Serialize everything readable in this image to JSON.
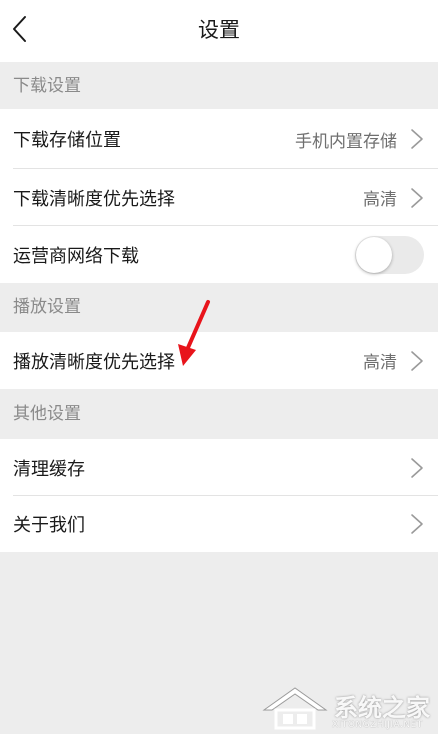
{
  "header": {
    "title": "设置",
    "back_icon": "chevron-left-icon"
  },
  "sections": {
    "download": {
      "title": "下载设置",
      "storage_location": {
        "label": "下载存储位置",
        "value": "手机内置存储"
      },
      "download_quality": {
        "label": "下载清晰度优先选择",
        "value": "高清"
      },
      "carrier_network": {
        "label": "运营商网络下载",
        "toggle_on": false
      }
    },
    "playback": {
      "title": "播放设置",
      "playback_quality": {
        "label": "播放清晰度优先选择",
        "value": "高清"
      }
    },
    "other": {
      "title": "其他设置",
      "clear_cache": {
        "label": "清理缓存"
      },
      "about_us": {
        "label": "关于我们"
      }
    }
  },
  "annotation": {
    "arrow_color": "#e8141b"
  },
  "watermark": {
    "text": "系统之家",
    "subtext": "XITONGZHIJIA.NET"
  },
  "colors": {
    "background": "#ededed",
    "row_background": "#ffffff",
    "section_title": "#8a8a8a",
    "value_text": "#6f6f6f"
  }
}
